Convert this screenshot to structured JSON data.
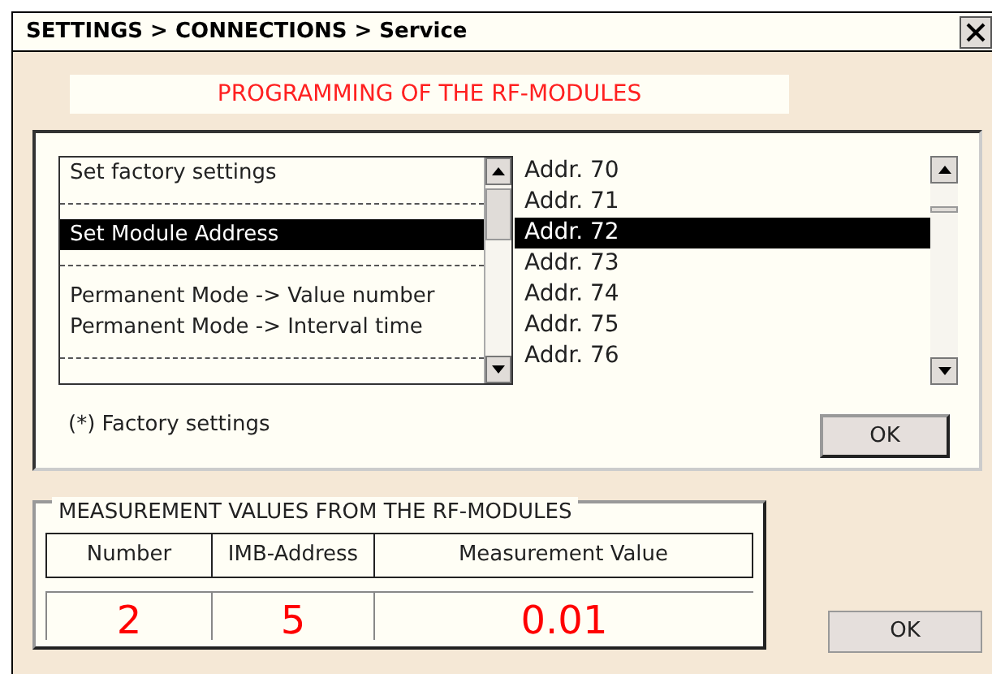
{
  "window": {
    "title": "SETTINGS > CONNECTIONS > Service"
  },
  "heading": "PROGRAMMING OF THE RF-MODULES",
  "function_list": [
    {
      "kind": "item",
      "label": "Set factory settings",
      "selected": false
    },
    {
      "kind": "separator"
    },
    {
      "kind": "item",
      "label": "Set Module Address",
      "selected": true
    },
    {
      "kind": "separator"
    },
    {
      "kind": "item",
      "label": "Permanent Mode -> Value number",
      "selected": false
    },
    {
      "kind": "item",
      "label": "Permanent Mode -> Interval time",
      "selected": false
    },
    {
      "kind": "separator"
    }
  ],
  "address_list": [
    {
      "label": "Addr. 70",
      "selected": false
    },
    {
      "label": "Addr. 71",
      "selected": false
    },
    {
      "label": "Addr. 72",
      "selected": true
    },
    {
      "label": "Addr. 73",
      "selected": false
    },
    {
      "label": "Addr. 74",
      "selected": false
    },
    {
      "label": "Addr. 75",
      "selected": false
    },
    {
      "label": "Addr. 76",
      "selected": false
    }
  ],
  "footnote": "(*) Factory settings",
  "program_button": "OK",
  "measurements": {
    "title": "MEASUREMENT VALUES FROM THE RF-MODULES",
    "columns": [
      "Number",
      "IMB-Address",
      "Measurement Value"
    ],
    "row": [
      "2",
      "5",
      "0.01"
    ]
  },
  "close_button": "OK"
}
